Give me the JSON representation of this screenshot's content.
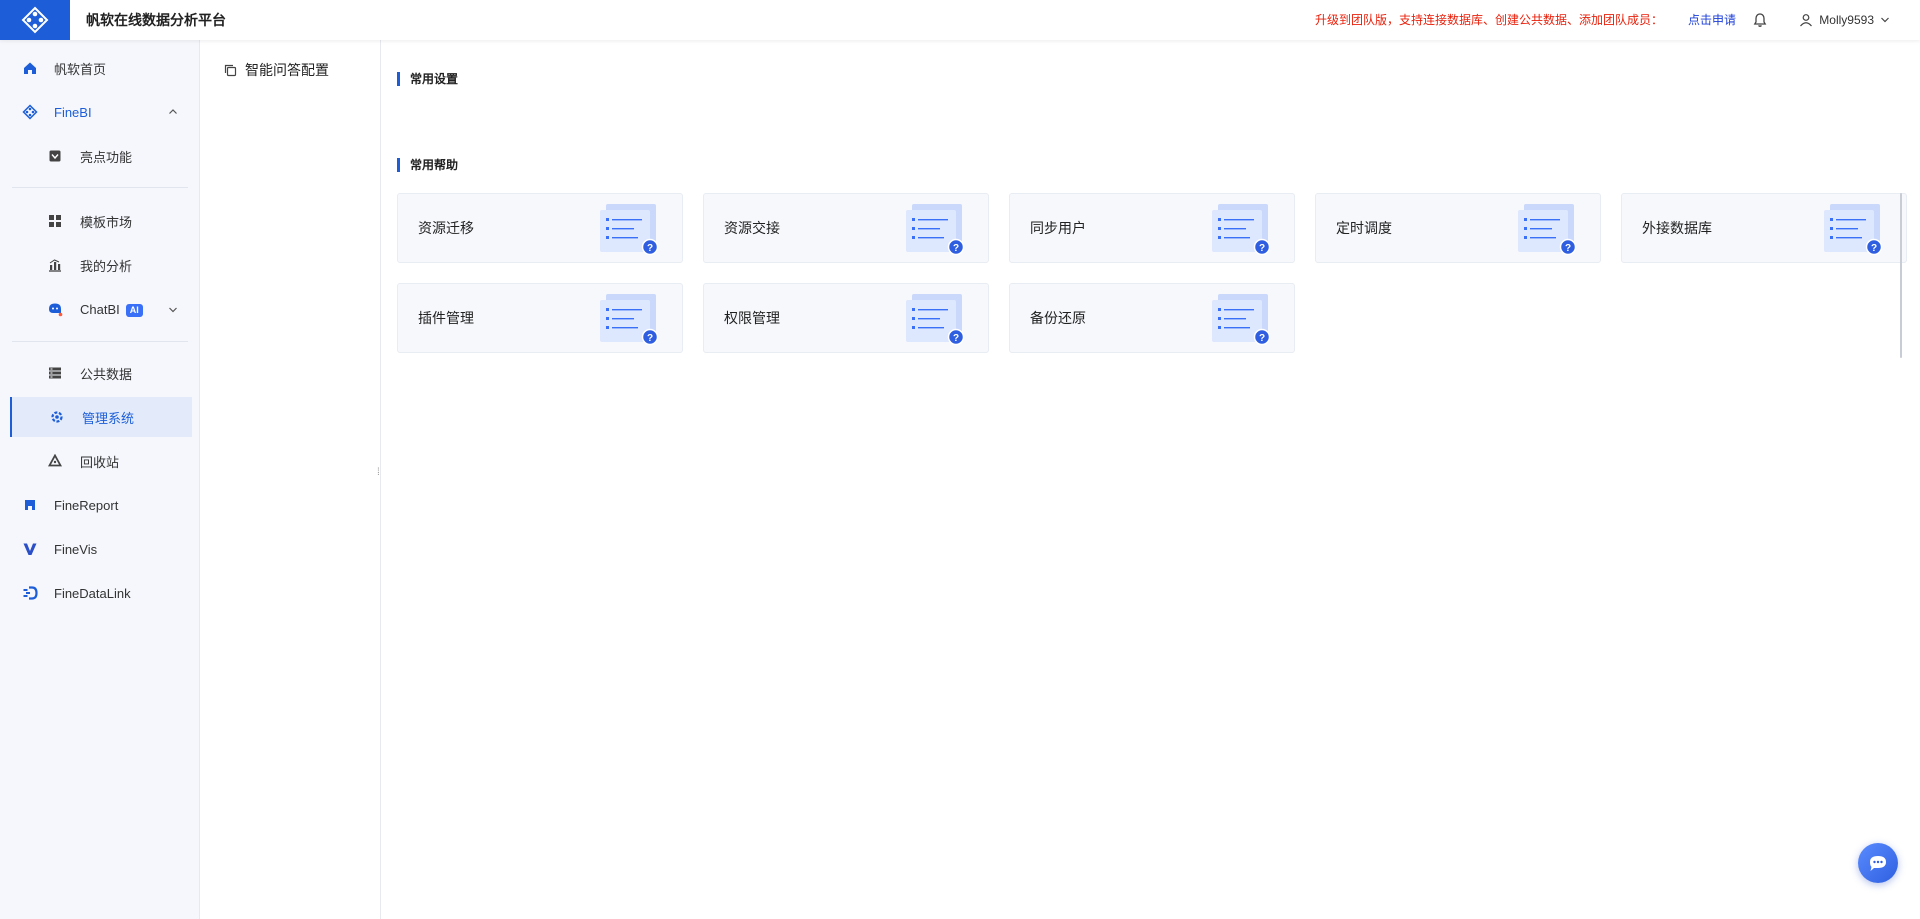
{
  "header": {
    "app_title": "帆软在线数据分析平台",
    "promo_text": "升级到团队版，支持连接数据库、创建公共数据、添加团队成员：",
    "apply_link": "点击申请",
    "username": "Molly9593"
  },
  "sidebar": {
    "home": "帆软首页",
    "finebi": "FineBI",
    "highlights": "亮点功能",
    "template_market": "模板市场",
    "my_analysis": "我的分析",
    "chatbi": "ChatBI",
    "ai_badge": "AI",
    "public_data": "公共数据",
    "admin_system": "管理系统",
    "recycle_bin": "回收站",
    "finereport": "FineReport",
    "finevis": "FineVis",
    "finedatalink": "FineDataLink"
  },
  "subpanel": {
    "smart_qa_config": "智能问答配置"
  },
  "main": {
    "common_settings_title": "常用设置",
    "common_help_title": "常用帮助",
    "help_cards": [
      "资源迁移",
      "资源交接",
      "同步用户",
      "定时调度",
      "外接数据库",
      "插件管理",
      "权限管理",
      "备份还原"
    ]
  },
  "colors": {
    "accent": "#1d5ed8",
    "promo": "#e8210c",
    "link": "#1d3fd8"
  }
}
